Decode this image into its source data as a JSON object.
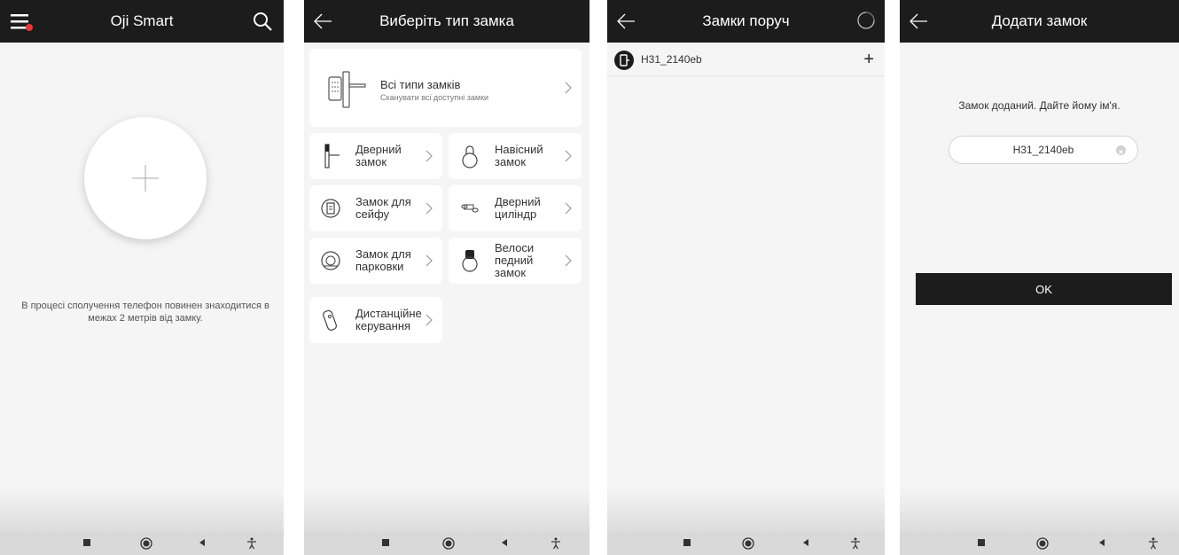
{
  "screen1": {
    "title": "Oji Smart",
    "hint": "В процесі сполучення телефон повинен знаходитися в межах 2 метрів від замку."
  },
  "screen2": {
    "title": "Виберіть тип замка",
    "all_types": {
      "title": "Всі типи замків",
      "subtitle": "Сканувати всі доступні замки"
    },
    "types": [
      {
        "label": "Дверний\nзамок",
        "icon": "door-lock-icon"
      },
      {
        "label": "Навісний\nзамок",
        "icon": "padlock-icon"
      },
      {
        "label": "Замок для\nсейфу",
        "icon": "safe-lock-icon"
      },
      {
        "label": "Дверний\nциліндр",
        "icon": "cylinder-icon"
      },
      {
        "label": "Замок для\nпарковки",
        "icon": "parking-lock-icon"
      },
      {
        "label": "Велоси\nпедний\nзамок",
        "icon": "bicycle-lock-icon"
      },
      {
        "label": "Дистанційне\nкерування",
        "icon": "remote-control-icon"
      }
    ]
  },
  "screen3": {
    "title": "Замки поруч",
    "devices": [
      {
        "name": "H31_2140eb"
      }
    ],
    "add_symbol": "+"
  },
  "screen4": {
    "title": "Додати замок",
    "hint": "Замок доданий. Дайте йому ім'я.",
    "name_value": "H31_2140eb",
    "ok_label": "OK"
  },
  "colors": {
    "header": "#1c1c1c",
    "background": "#f5f5f5",
    "card": "#ffffff",
    "accent_red": "#e53935"
  }
}
